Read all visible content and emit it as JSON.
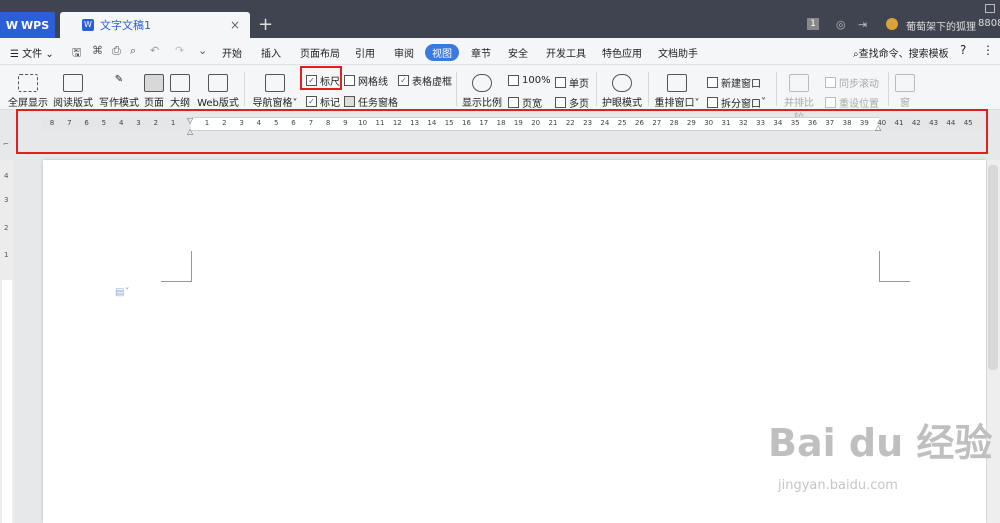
{
  "titlebar": {
    "app_name": "WPS",
    "document_tab": "文字文稿1",
    "close_glyph": "×",
    "add_glyph": "+",
    "badge": "1",
    "user_name": "葡萄架下的狐狸",
    "count": "8808"
  },
  "menubar": {
    "file_label": "文件",
    "items": [
      "开始",
      "插入",
      "页面布局",
      "引用",
      "审阅",
      "视图",
      "章节",
      "安全",
      "开发工具",
      "特色应用",
      "文档助手"
    ],
    "search_label": "查找命令、搜索模板",
    "help_glyph": "?"
  },
  "toolbar": {
    "fullscreen": "全屏显示",
    "reading": "阅读版式",
    "writing": "写作模式",
    "page": "页面",
    "outline": "大纲",
    "web": "Web版式",
    "nav_pane": "导航窗格",
    "ruler": "标尺",
    "gridlines": "网格线",
    "table_lines": "表格虚框",
    "marks": "标记",
    "task_pane": "任务窗格",
    "zoom": "显示比例",
    "zoom_100": "100%",
    "page_width": "页宽",
    "single_page": "单页",
    "multi_page": "多页",
    "eye_mode": "护眼模式",
    "arrange": "重排窗口",
    "new_window": "新建窗口",
    "split_window": "拆分窗口",
    "side_by_side": "并排比较",
    "sync_scroll": "同步滚动",
    "reset_position": "重设位置",
    "window": "窗"
  },
  "ruler": {
    "numbers_left": [
      "8",
      "7",
      "6",
      "5",
      "4",
      "3",
      "2",
      "1"
    ],
    "numbers_right": [
      "1",
      "2",
      "3",
      "4",
      "5",
      "6",
      "7",
      "8",
      "9",
      "10",
      "11",
      "12",
      "13",
      "14",
      "15",
      "16",
      "17",
      "18",
      "19",
      "20",
      "21",
      "22",
      "23",
      "24",
      "25",
      "26",
      "27",
      "28",
      "29",
      "30",
      "31",
      "32",
      "33",
      "34",
      "35",
      "36",
      "37",
      "38",
      "39",
      "40",
      "41",
      "42",
      "43",
      "44",
      "45"
    ],
    "vertical_numbers": [
      "4",
      "3",
      "2",
      "1"
    ]
  },
  "watermark": {
    "brand": "Bai du 经验",
    "url": "jingyan.baidu.com"
  }
}
